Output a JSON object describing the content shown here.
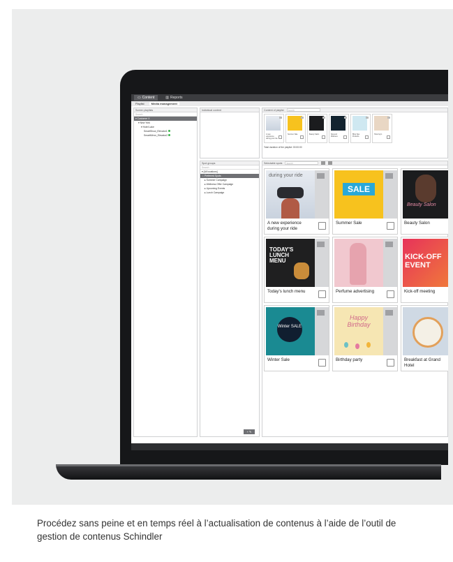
{
  "app": {
    "tabs": [
      {
        "label": "Content"
      },
      {
        "label": "Reports"
      }
    ],
    "subtabs": [
      {
        "label": "Playlist"
      },
      {
        "label": "Media management"
      }
    ]
  },
  "panels": {
    "screen_playlists": {
      "title": "Screen playlists",
      "search_placeholder": "Search",
      "items": [
        "Customer X",
        "New York",
        "Hotel Lake",
        "SmartShow_Elevator1",
        "SmartMirror_Elevator2"
      ]
    },
    "individual_content": {
      "title": "Individual content"
    },
    "content_of_playlist": {
      "title": "Content of playlist",
      "search_placeholder": "Search",
      "items": [
        "A new experience during your ride",
        "Summer Sale",
        "Beauty Salon",
        "Spa and Wellness",
        "Bliss Spa Products",
        "Hotel Gym"
      ],
      "total_duration": "Total duration of the playlist: 00:00:00"
    },
    "spot_groups": {
      "title": "Spot groups",
      "search_placeholder": "Search",
      "items": [
        "[All locations]",
        "Preferred Spots",
        "Summer Campaign",
        "Wellness Offer Campaign",
        "Upcoming Events",
        "Lunch Campaign"
      ]
    },
    "selectable_spots": {
      "title": "Selectable spots",
      "search_placeholder": "Search",
      "cards": [
        {
          "title": "A new experience during your ride",
          "pic_text": "during your ride"
        },
        {
          "title": "Summer Sale",
          "pic_text": "SALE"
        },
        {
          "title": "Beauty Salon",
          "pic_text": "Beauty Salon"
        },
        {
          "title": "Today's lunch menu",
          "pic_text": "TODAY'S LUNCH MENU"
        },
        {
          "title": "Perfume advertising",
          "pic_text": ""
        },
        {
          "title": "Kick-off meeting",
          "pic_text": "KICK-OFF EVENT"
        },
        {
          "title": "Winter Sale",
          "pic_text": "Winter SALE"
        },
        {
          "title": "Birthday party",
          "pic_text": "Happy Birthday"
        },
        {
          "title": "Breakfast at Grand Hotel",
          "pic_text": ""
        }
      ]
    }
  },
  "caption": "Procédez sans peine et en temps réel à l’actualisation de contenus à l’aide de l’outil de gestion de contenus Schindler",
  "colors": {
    "background": "#eceded",
    "laptop": "#161719",
    "selected": "#6f7074",
    "online": "#3cb44b"
  }
}
